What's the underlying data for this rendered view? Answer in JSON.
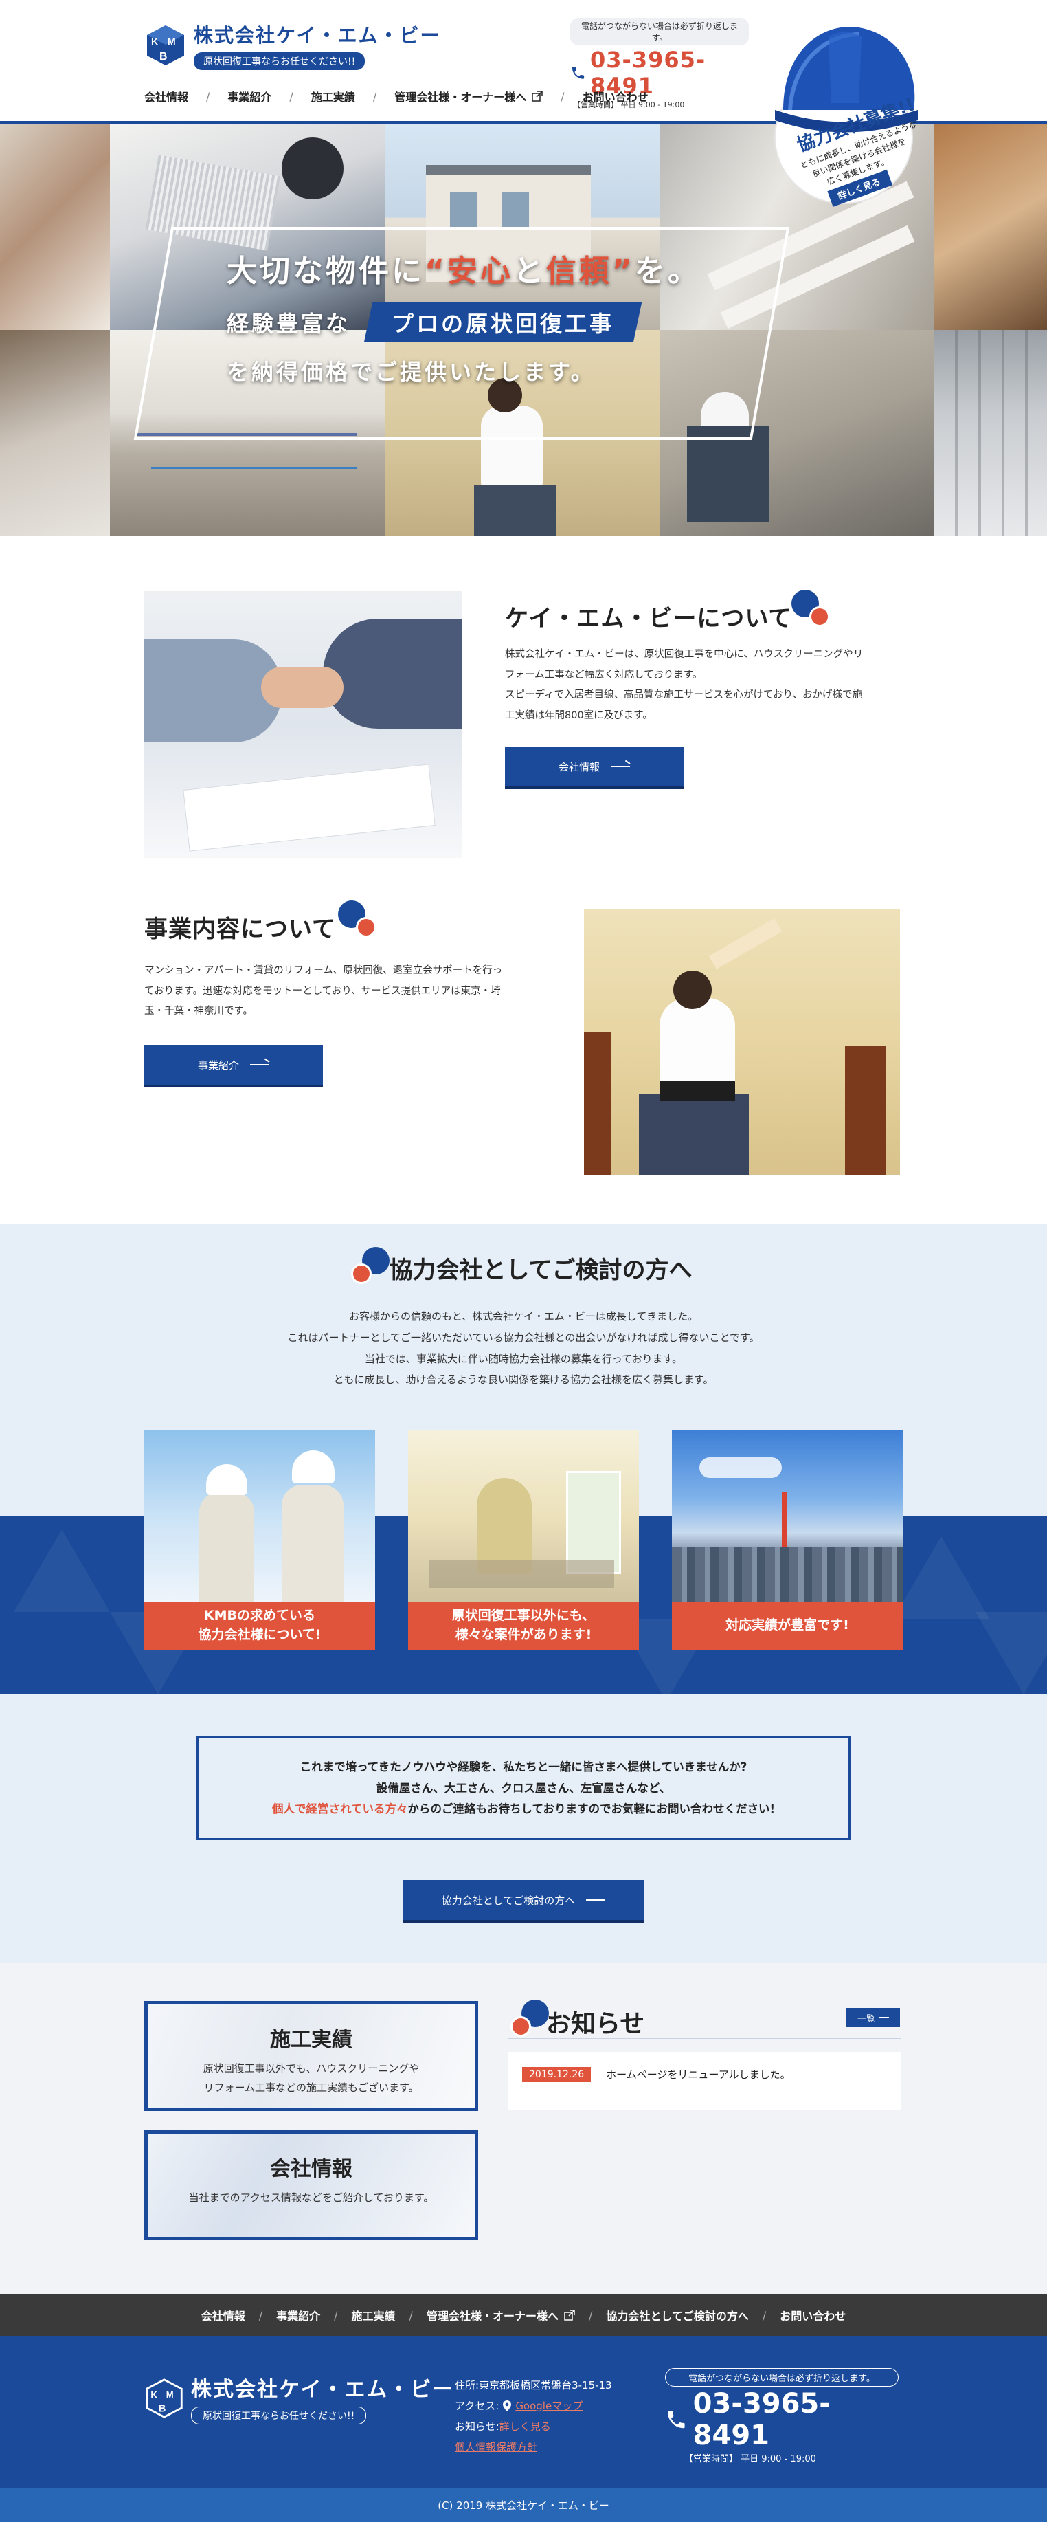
{
  "header": {
    "company_name": "株式会社ケイ・エム・ビー",
    "tagline": "原状回復工事ならお任せください!!",
    "tel_note": "電話がつながらない場合は必ず折り返します。",
    "tel": "03-3965-8491",
    "hours": "【営業時間】 平日 9:00 - 19:00",
    "nav": [
      "会社情報",
      "事業紹介",
      "施工実績",
      "管理会社様・オーナー様へ",
      "お問い合わせ"
    ],
    "badge": {
      "title": "協力会社募集!!",
      "text_1": "ともに成長し、助け合えるような",
      "text_2": "良い関係を築ける会社様を",
      "text_3": "広く募集します。",
      "more": "詳しく見る"
    }
  },
  "hero": {
    "line1_a": "大切な物件に",
    "line1_q1": "“",
    "line1_b": "安心",
    "line1_c": "と",
    "line1_d": "信頼",
    "line1_q2": "”",
    "line1_e": "を。",
    "line2_a": "経験豊富な",
    "line2_pill": "プロの原状回復工事",
    "line3": "を納得価格でご提供いたします。"
  },
  "about": {
    "title": "ケイ・エム・ビーについて",
    "p1": "株式会社ケイ・エム・ビーは、原状回復工事を中心に、ハウスクリーニングやリ",
    "p2": "フォーム工事など幅広く対応しております。",
    "p3": "スピーディで入居者目線、高品質な施工サービスを心がけており、おかげ様で施",
    "p4": "工実績は年間800室に及びます。",
    "button": "会社情報"
  },
  "business": {
    "title": "事業内容について",
    "p1": "マンション・アパート・賃貸のリフォーム、原状回復、退室立会サポートを行っ",
    "p2": "ております。迅速な対応をモットーとしており、サービス提供エリアは東京・埼",
    "p3": "玉・千葉・神奈川です。",
    "button": "事業紹介"
  },
  "partner": {
    "title": "協力会社としてご検討の方へ",
    "p1": "お客様からの信頼のもと、株式会社ケイ・エム・ビーは成長してきました。",
    "p2": "これはパートナーとしてご一緒いただいている協力会社様との出会いがなければ成し得ないことです。",
    "p3": "当社では、事業拡大に伴い随時協力会社様の募集を行っております。",
    "p4": "ともに成長し、助け合えるような良い関係を築ける協力会社様を広く募集します。",
    "cards": [
      {
        "line1": "KMBの求めている",
        "line2": "協力会社様について!"
      },
      {
        "line1": "原状回復工事以外にも、",
        "line2": "様々な案件があります!"
      },
      {
        "line1": "対応実績が豊富です!",
        "line2": ""
      }
    ],
    "notice_1": "これまで培ってきたノウハウや経験を、私たちと一緒に皆さまへ提供していきませんか?",
    "notice_2": "設備屋さん、大工さん、クロス屋さん、左官屋さんなど、",
    "notice_3_red": "個人で経営されている方々",
    "notice_3_rest": "からのご連絡もお待ちしておりますのでお気軽にお問い合わせください!",
    "button": "協力会社としてご検討の方へ"
  },
  "links": {
    "works_title": "施工実績",
    "works_1": "原状回復工事以外でも、ハウスクリーニングや",
    "works_2": "リフォーム工事などの施工実績もございます。",
    "company_title": "会社情報",
    "company_1": "当社までのアクセス情報などをご紹介しております。"
  },
  "news": {
    "title": "お知らせ",
    "list_button": "一覧",
    "items": [
      {
        "date": "2019.12.26",
        "text": "ホームページをリニューアルしました。"
      }
    ]
  },
  "footer": {
    "nav": [
      "会社情報",
      "事業紹介",
      "施工実績",
      "管理会社様・オーナー様へ",
      "協力会社としてご検討の方へ",
      "お問い合わせ"
    ],
    "company_name": "株式会社ケイ・エム・ビー",
    "tagline": "原状回復工事ならお任せください!!",
    "address_label": "住所:",
    "address": "東京都板橋区常盤台3-15-13",
    "access_label": "アクセス:",
    "access_link": "Googleマップ",
    "news_label": "お知らせ:",
    "news_link": "詳しく見る",
    "privacy": "個人情報保護方針",
    "tel_note": "電話がつながらない場合は必ず折り返します。",
    "tel": "03-3965-8491",
    "hours": "【営業時間】 平日 9:00 - 19:00",
    "copyright": "(C) 2019 株式会社ケイ・エム・ビー"
  },
  "colors": {
    "brand_blue": "#1a4a99",
    "accent_red": "#e0543c",
    "light_bg": "#e6eef8"
  }
}
